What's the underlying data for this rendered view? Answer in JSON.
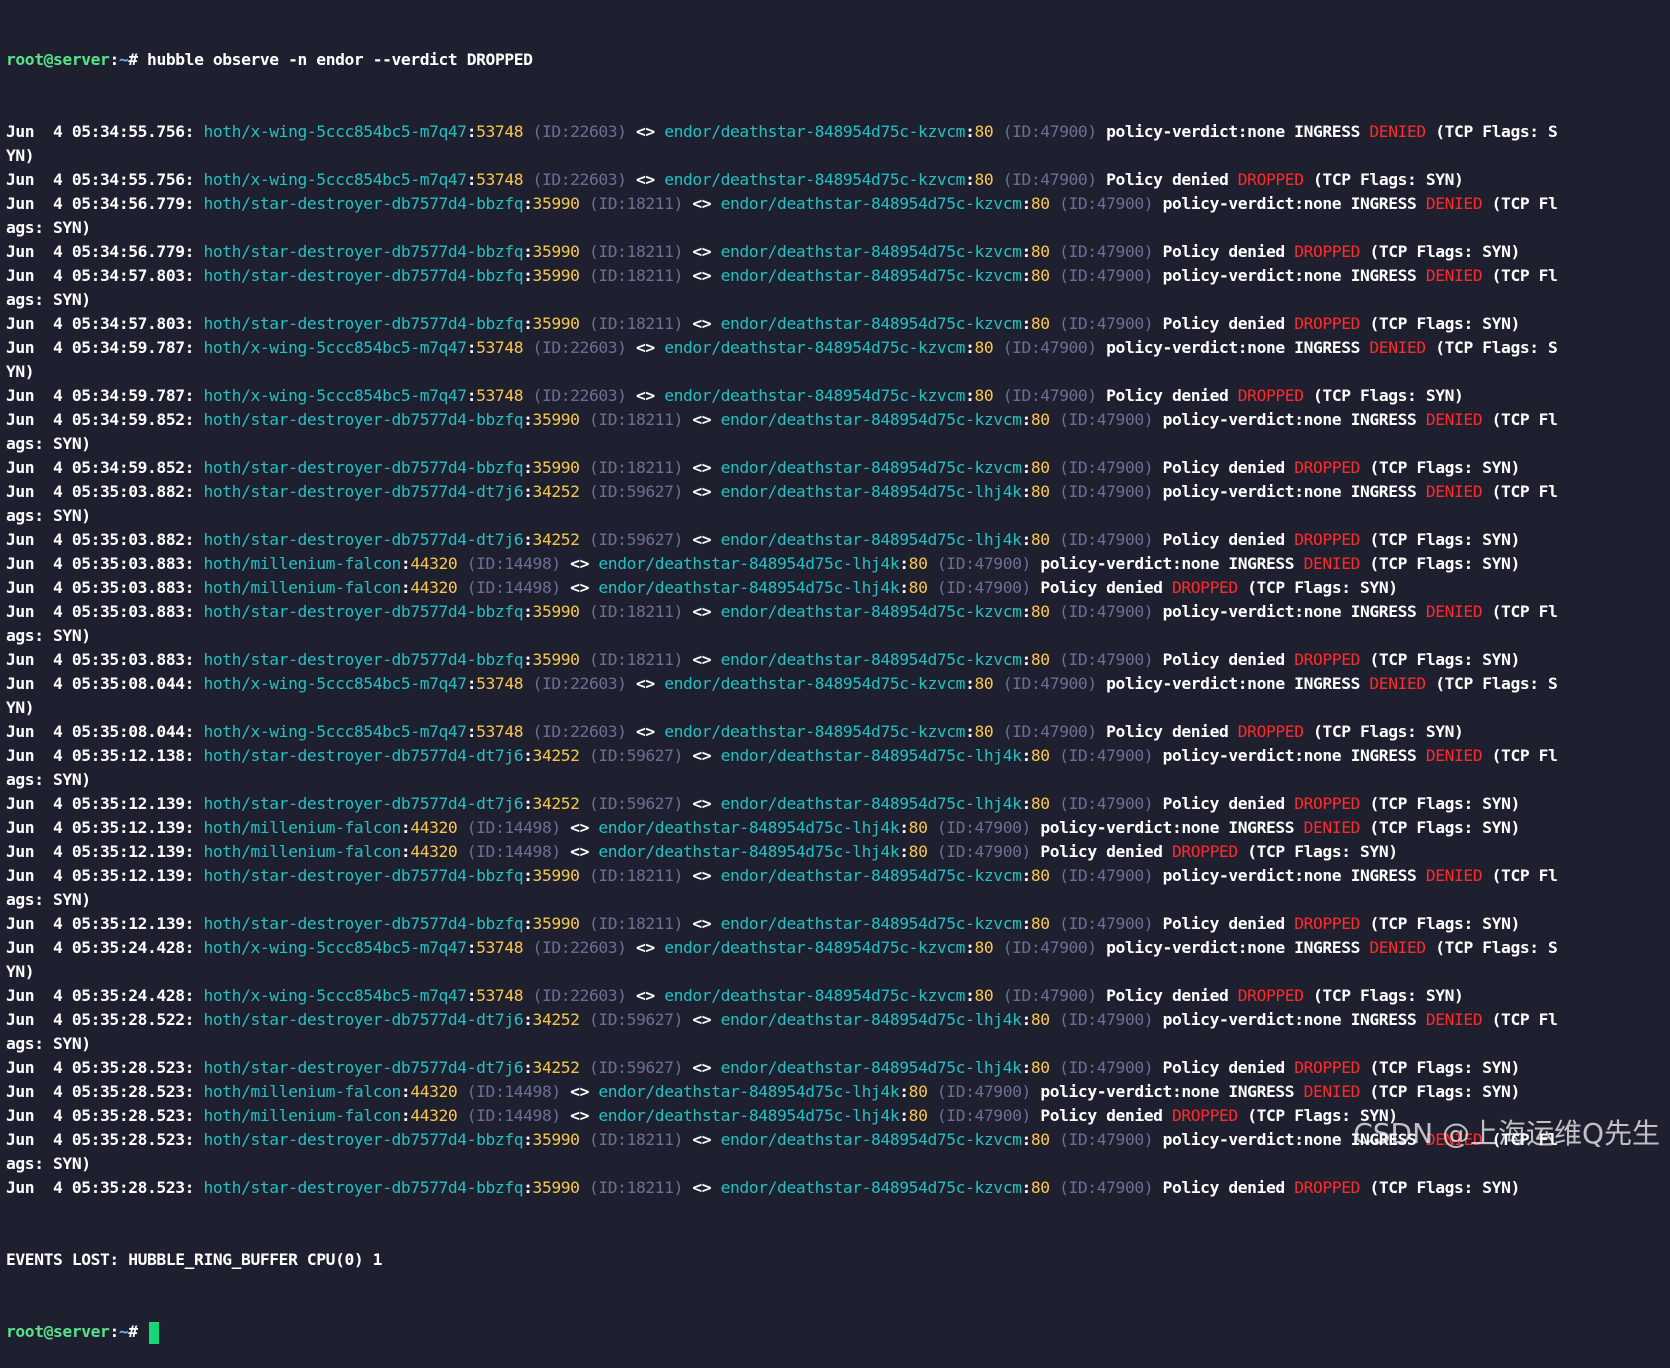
{
  "prompt": {
    "user": "root@server",
    "path": "~",
    "symbol": "#"
  },
  "command": " hubble observe -n endor --verdict DROPPED",
  "flows": [
    {
      "ts": "Jun  4 05:34:55.756:",
      "src": "hoth/x-wing-5ccc854bc5-m7q47",
      "sport": "53748",
      "sid": "(ID:22603)",
      "dst": "endor/deathstar-848954d75c-kzvcm",
      "dport": "80",
      "did": "(ID:47900)",
      "kind": "verdict",
      "cont": "YN)"
    },
    {
      "ts": "Jun  4 05:34:55.756:",
      "src": "hoth/x-wing-5ccc854bc5-m7q47",
      "sport": "53748",
      "sid": "(ID:22603)",
      "dst": "endor/deathstar-848954d75c-kzvcm",
      "dport": "80",
      "did": "(ID:47900)",
      "kind": "drop",
      "cont": ""
    },
    {
      "ts": "Jun  4 05:34:56.779:",
      "src": "hoth/star-destroyer-db7577d4-bbzfq",
      "sport": "35990",
      "sid": "(ID:18211)",
      "dst": "endor/deathstar-848954d75c-kzvcm",
      "dport": "80",
      "did": "(ID:47900)",
      "kind": "verdict",
      "cont": "ags: SYN)"
    },
    {
      "ts": "Jun  4 05:34:56.779:",
      "src": "hoth/star-destroyer-db7577d4-bbzfq",
      "sport": "35990",
      "sid": "(ID:18211)",
      "dst": "endor/deathstar-848954d75c-kzvcm",
      "dport": "80",
      "did": "(ID:47900)",
      "kind": "drop",
      "cont": ""
    },
    {
      "ts": "Jun  4 05:34:57.803:",
      "src": "hoth/star-destroyer-db7577d4-bbzfq",
      "sport": "35990",
      "sid": "(ID:18211)",
      "dst": "endor/deathstar-848954d75c-kzvcm",
      "dport": "80",
      "did": "(ID:47900)",
      "kind": "verdict",
      "cont": "ags: SYN)"
    },
    {
      "ts": "Jun  4 05:34:57.803:",
      "src": "hoth/star-destroyer-db7577d4-bbzfq",
      "sport": "35990",
      "sid": "(ID:18211)",
      "dst": "endor/deathstar-848954d75c-kzvcm",
      "dport": "80",
      "did": "(ID:47900)",
      "kind": "drop",
      "cont": ""
    },
    {
      "ts": "Jun  4 05:34:59.787:",
      "src": "hoth/x-wing-5ccc854bc5-m7q47",
      "sport": "53748",
      "sid": "(ID:22603)",
      "dst": "endor/deathstar-848954d75c-kzvcm",
      "dport": "80",
      "did": "(ID:47900)",
      "kind": "verdict",
      "cont": "YN)"
    },
    {
      "ts": "Jun  4 05:34:59.787:",
      "src": "hoth/x-wing-5ccc854bc5-m7q47",
      "sport": "53748",
      "sid": "(ID:22603)",
      "dst": "endor/deathstar-848954d75c-kzvcm",
      "dport": "80",
      "did": "(ID:47900)",
      "kind": "drop",
      "cont": ""
    },
    {
      "ts": "Jun  4 05:34:59.852:",
      "src": "hoth/star-destroyer-db7577d4-bbzfq",
      "sport": "35990",
      "sid": "(ID:18211)",
      "dst": "endor/deathstar-848954d75c-kzvcm",
      "dport": "80",
      "did": "(ID:47900)",
      "kind": "verdict",
      "cont": "ags: SYN)"
    },
    {
      "ts": "Jun  4 05:34:59.852:",
      "src": "hoth/star-destroyer-db7577d4-bbzfq",
      "sport": "35990",
      "sid": "(ID:18211)",
      "dst": "endor/deathstar-848954d75c-kzvcm",
      "dport": "80",
      "did": "(ID:47900)",
      "kind": "drop",
      "cont": ""
    },
    {
      "ts": "Jun  4 05:35:03.882:",
      "src": "hoth/star-destroyer-db7577d4-dt7j6",
      "sport": "34252",
      "sid": "(ID:59627)",
      "dst": "endor/deathstar-848954d75c-lhj4k",
      "dport": "80",
      "did": "(ID:47900)",
      "kind": "verdict",
      "cont": "ags: SYN)"
    },
    {
      "ts": "Jun  4 05:35:03.882:",
      "src": "hoth/star-destroyer-db7577d4-dt7j6",
      "sport": "34252",
      "sid": "(ID:59627)",
      "dst": "endor/deathstar-848954d75c-lhj4k",
      "dport": "80",
      "did": "(ID:47900)",
      "kind": "drop",
      "cont": ""
    },
    {
      "ts": "Jun  4 05:35:03.883:",
      "src": "hoth/millenium-falcon",
      "sport": "44320",
      "sid": "(ID:14498)",
      "dst": "endor/deathstar-848954d75c-lhj4k",
      "dport": "80",
      "did": "(ID:47900)",
      "kind": "verdict",
      "cont": ""
    },
    {
      "ts": "Jun  4 05:35:03.883:",
      "src": "hoth/millenium-falcon",
      "sport": "44320",
      "sid": "(ID:14498)",
      "dst": "endor/deathstar-848954d75c-lhj4k",
      "dport": "80",
      "did": "(ID:47900)",
      "kind": "drop",
      "cont": ""
    },
    {
      "ts": "Jun  4 05:35:03.883:",
      "src": "hoth/star-destroyer-db7577d4-bbzfq",
      "sport": "35990",
      "sid": "(ID:18211)",
      "dst": "endor/deathstar-848954d75c-kzvcm",
      "dport": "80",
      "did": "(ID:47900)",
      "kind": "verdict",
      "cont": "ags: SYN)"
    },
    {
      "ts": "Jun  4 05:35:03.883:",
      "src": "hoth/star-destroyer-db7577d4-bbzfq",
      "sport": "35990",
      "sid": "(ID:18211)",
      "dst": "endor/deathstar-848954d75c-kzvcm",
      "dport": "80",
      "did": "(ID:47900)",
      "kind": "drop",
      "cont": ""
    },
    {
      "ts": "Jun  4 05:35:08.044:",
      "src": "hoth/x-wing-5ccc854bc5-m7q47",
      "sport": "53748",
      "sid": "(ID:22603)",
      "dst": "endor/deathstar-848954d75c-kzvcm",
      "dport": "80",
      "did": "(ID:47900)",
      "kind": "verdict",
      "cont": "YN)"
    },
    {
      "ts": "Jun  4 05:35:08.044:",
      "src": "hoth/x-wing-5ccc854bc5-m7q47",
      "sport": "53748",
      "sid": "(ID:22603)",
      "dst": "endor/deathstar-848954d75c-kzvcm",
      "dport": "80",
      "did": "(ID:47900)",
      "kind": "drop",
      "cont": ""
    },
    {
      "ts": "Jun  4 05:35:12.138:",
      "src": "hoth/star-destroyer-db7577d4-dt7j6",
      "sport": "34252",
      "sid": "(ID:59627)",
      "dst": "endor/deathstar-848954d75c-lhj4k",
      "dport": "80",
      "did": "(ID:47900)",
      "kind": "verdict",
      "cont": "ags: SYN)"
    },
    {
      "ts": "Jun  4 05:35:12.139:",
      "src": "hoth/star-destroyer-db7577d4-dt7j6",
      "sport": "34252",
      "sid": "(ID:59627)",
      "dst": "endor/deathstar-848954d75c-lhj4k",
      "dport": "80",
      "did": "(ID:47900)",
      "kind": "drop",
      "cont": ""
    },
    {
      "ts": "Jun  4 05:35:12.139:",
      "src": "hoth/millenium-falcon",
      "sport": "44320",
      "sid": "(ID:14498)",
      "dst": "endor/deathstar-848954d75c-lhj4k",
      "dport": "80",
      "did": "(ID:47900)",
      "kind": "verdict",
      "cont": ""
    },
    {
      "ts": "Jun  4 05:35:12.139:",
      "src": "hoth/millenium-falcon",
      "sport": "44320",
      "sid": "(ID:14498)",
      "dst": "endor/deathstar-848954d75c-lhj4k",
      "dport": "80",
      "did": "(ID:47900)",
      "kind": "drop",
      "cont": ""
    },
    {
      "ts": "Jun  4 05:35:12.139:",
      "src": "hoth/star-destroyer-db7577d4-bbzfq",
      "sport": "35990",
      "sid": "(ID:18211)",
      "dst": "endor/deathstar-848954d75c-kzvcm",
      "dport": "80",
      "did": "(ID:47900)",
      "kind": "verdict",
      "cont": "ags: SYN)"
    },
    {
      "ts": "Jun  4 05:35:12.139:",
      "src": "hoth/star-destroyer-db7577d4-bbzfq",
      "sport": "35990",
      "sid": "(ID:18211)",
      "dst": "endor/deathstar-848954d75c-kzvcm",
      "dport": "80",
      "did": "(ID:47900)",
      "kind": "drop",
      "cont": ""
    },
    {
      "ts": "Jun  4 05:35:24.428:",
      "src": "hoth/x-wing-5ccc854bc5-m7q47",
      "sport": "53748",
      "sid": "(ID:22603)",
      "dst": "endor/deathstar-848954d75c-kzvcm",
      "dport": "80",
      "did": "(ID:47900)",
      "kind": "verdict",
      "cont": "YN)"
    },
    {
      "ts": "Jun  4 05:35:24.428:",
      "src": "hoth/x-wing-5ccc854bc5-m7q47",
      "sport": "53748",
      "sid": "(ID:22603)",
      "dst": "endor/deathstar-848954d75c-kzvcm",
      "dport": "80",
      "did": "(ID:47900)",
      "kind": "drop",
      "cont": ""
    },
    {
      "ts": "Jun  4 05:35:28.522:",
      "src": "hoth/star-destroyer-db7577d4-dt7j6",
      "sport": "34252",
      "sid": "(ID:59627)",
      "dst": "endor/deathstar-848954d75c-lhj4k",
      "dport": "80",
      "did": "(ID:47900)",
      "kind": "verdict",
      "cont": "ags: SYN)"
    },
    {
      "ts": "Jun  4 05:35:28.523:",
      "src": "hoth/star-destroyer-db7577d4-dt7j6",
      "sport": "34252",
      "sid": "(ID:59627)",
      "dst": "endor/deathstar-848954d75c-lhj4k",
      "dport": "80",
      "did": "(ID:47900)",
      "kind": "drop",
      "cont": ""
    },
    {
      "ts": "Jun  4 05:35:28.523:",
      "src": "hoth/millenium-falcon",
      "sport": "44320",
      "sid": "(ID:14498)",
      "dst": "endor/deathstar-848954d75c-lhj4k",
      "dport": "80",
      "did": "(ID:47900)",
      "kind": "verdict",
      "cont": ""
    },
    {
      "ts": "Jun  4 05:35:28.523:",
      "src": "hoth/millenium-falcon",
      "sport": "44320",
      "sid": "(ID:14498)",
      "dst": "endor/deathstar-848954d75c-lhj4k",
      "dport": "80",
      "did": "(ID:47900)",
      "kind": "drop",
      "cont": ""
    },
    {
      "ts": "Jun  4 05:35:28.523:",
      "src": "hoth/star-destroyer-db7577d4-bbzfq",
      "sport": "35990",
      "sid": "(ID:18211)",
      "dst": "endor/deathstar-848954d75c-kzvcm",
      "dport": "80",
      "did": "(ID:47900)",
      "kind": "verdict",
      "cont": "ags: SYN)"
    },
    {
      "ts": "Jun  4 05:35:28.523:",
      "src": "hoth/star-destroyer-db7577d4-bbzfq",
      "sport": "35990",
      "sid": "(ID:18211)",
      "dst": "endor/deathstar-848954d75c-kzvcm",
      "dport": "80",
      "did": "(ID:47900)",
      "kind": "drop",
      "cont": ""
    }
  ],
  "labels": {
    "arrow": "<>",
    "verdict_prefix": "policy-verdict:none INGRESS",
    "denied": "DENIED",
    "drop_prefix": "Policy denied",
    "dropped": "DROPPED",
    "verdict_suffix_short": "(TCP Flags: S",
    "verdict_suffix_mid": "(TCP Fl",
    "verdict_suffix_full": "(TCP Flags: SYN)",
    "drop_suffix": "(TCP Flags: SYN)"
  },
  "footer": "EVENTS LOST: HUBBLE_RING_BUFFER CPU(0) 1",
  "watermark": "CSDN @上海运维Q先生",
  "colors": {
    "background": "#1e2030",
    "prompt_user": "#57e389",
    "endpoint": "#22c1c3",
    "port": "#f9c74f",
    "identity": "#6c6f93",
    "denied": "#ff2a2a",
    "cursor": "#17d67a"
  }
}
